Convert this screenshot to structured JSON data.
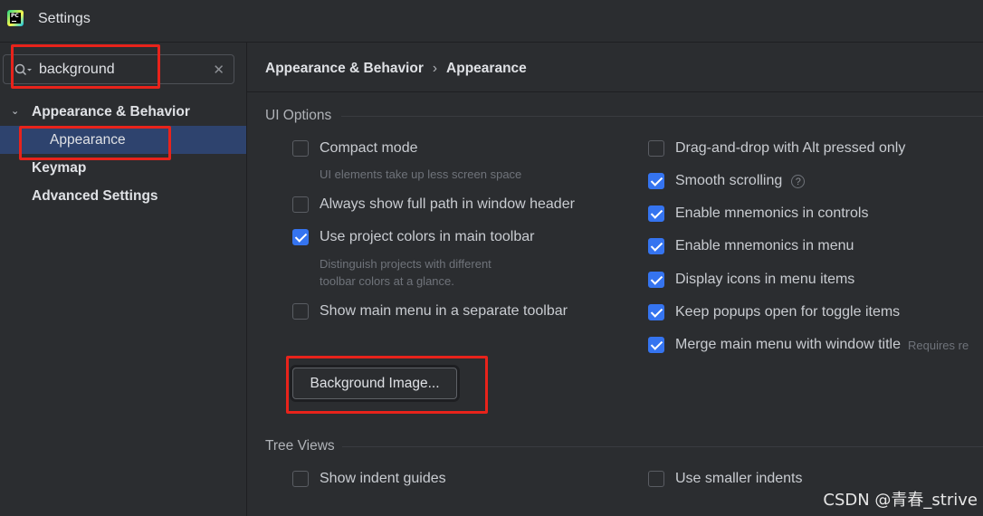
{
  "window": {
    "title": "Settings",
    "logo_text": "PC"
  },
  "search": {
    "value": "background"
  },
  "sidebar": {
    "items": [
      {
        "label": "Appearance & Behavior"
      },
      {
        "label": "Appearance"
      },
      {
        "label": "Keymap"
      },
      {
        "label": "Advanced Settings"
      }
    ]
  },
  "breadcrumb": {
    "parent": "Appearance & Behavior",
    "separator": "›",
    "current": "Appearance"
  },
  "ui_options": {
    "title": "UI Options",
    "left": [
      {
        "label": "Compact mode",
        "checked": false,
        "hint": "UI elements take up less screen space"
      },
      {
        "label": "Always show full path in window header",
        "checked": false
      },
      {
        "label": "Use project colors in main toolbar",
        "checked": true,
        "hint_line1": "Distinguish projects with different",
        "hint_line2": "toolbar colors at a glance."
      },
      {
        "label": "Show main menu in a separate toolbar",
        "checked": false
      }
    ],
    "right": [
      {
        "label": "Drag-and-drop with Alt pressed only",
        "checked": false
      },
      {
        "label": "Smooth scrolling",
        "checked": true,
        "help": "?"
      },
      {
        "label": "Enable mnemonics in controls",
        "checked": true
      },
      {
        "label": "Enable mnemonics in menu",
        "checked": true
      },
      {
        "label": "Display icons in menu items",
        "checked": true
      },
      {
        "label": "Keep popups open for toggle items",
        "checked": true
      },
      {
        "label": "Merge main menu with window title",
        "checked": true,
        "note": "Requires re"
      }
    ],
    "background_button": "Background Image..."
  },
  "tree_views": {
    "title": "Tree Views",
    "left": {
      "label": "Show indent guides",
      "checked": false
    },
    "right": {
      "label": "Use smaller indents",
      "checked": false
    }
  },
  "watermark": "CSDN @青春_strive",
  "colors": {
    "background": "#2b2d30",
    "selection": "#2e436e",
    "checkbox_checked": "#3574f0",
    "annotation": "#e8231b"
  }
}
